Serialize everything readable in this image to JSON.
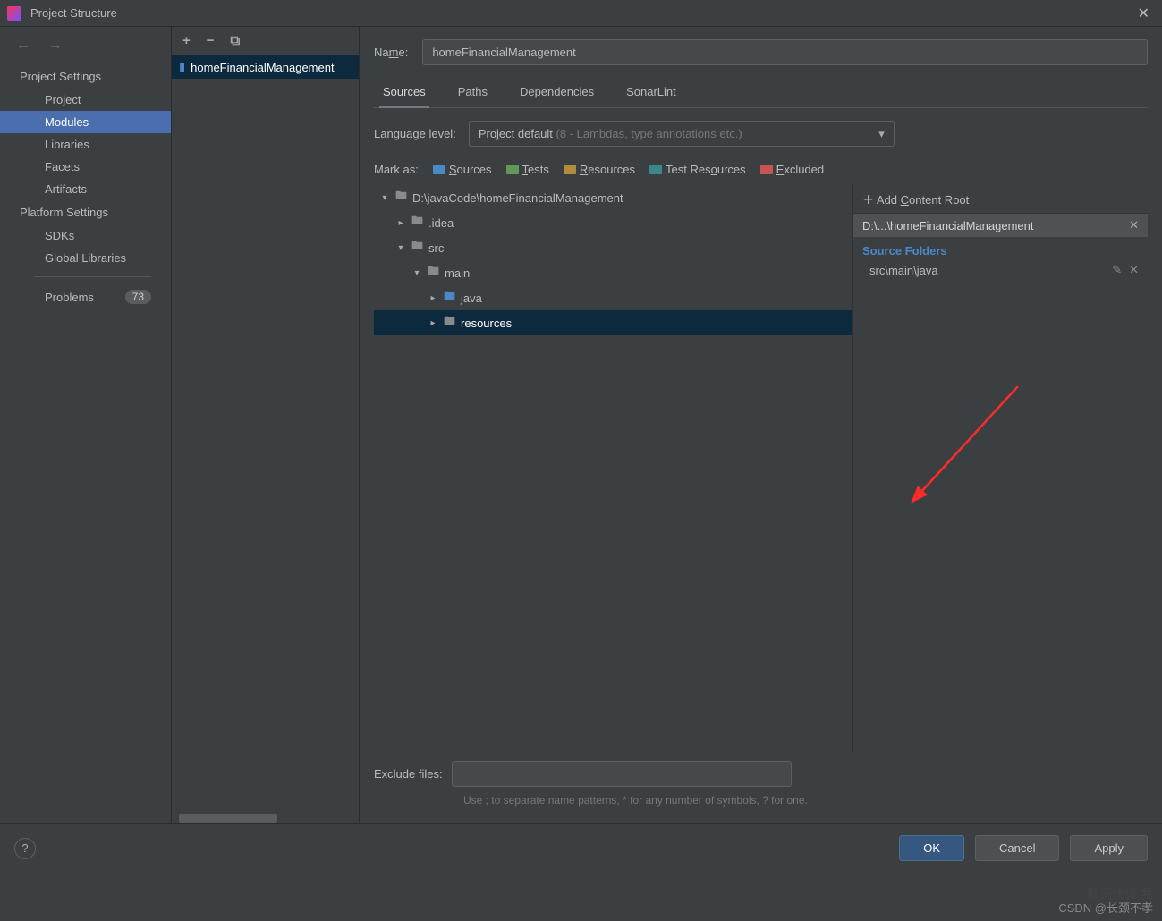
{
  "title": "Project Structure",
  "leftNav": {
    "back_arrow": "←",
    "fwd_arrow": "→",
    "sections": [
      {
        "header": "Project Settings",
        "items": [
          "Project",
          "Modules",
          "Libraries",
          "Facets",
          "Artifacts"
        ],
        "selected": "Modules"
      },
      {
        "header": "Platform Settings",
        "items": [
          "SDKs",
          "Global Libraries"
        ]
      }
    ],
    "problems": {
      "label": "Problems",
      "count": "73"
    }
  },
  "modulesList": {
    "toolbar": {
      "add": "+",
      "remove": "−",
      "copy": "⧉"
    },
    "selected": "homeFinancialManagement"
  },
  "form": {
    "name_label": "Name:",
    "name_value": "homeFinancialManagement",
    "tabs": [
      "Sources",
      "Paths",
      "Dependencies",
      "SonarLint"
    ],
    "active_tab": "Sources",
    "lang_label": "Language level:",
    "lang_value": "Project default",
    "lang_hint": " (8 - Lambdas, type annotations etc.)",
    "mark_label": "Mark as:",
    "marks": {
      "sources": "Sources",
      "tests": "Tests",
      "resources": "Resources",
      "test_resources": "Test Resources",
      "excluded": "Excluded"
    },
    "tree": {
      "root": "D:\\javaCode\\homeFinancialManagement",
      "idea": ".idea",
      "src": "src",
      "main": "main",
      "java": "java",
      "resources": "resources"
    },
    "contentRoot": {
      "add_label": "Add Content Root",
      "path": "D:\\...\\homeFinancialManagement",
      "source_folders_header": "Source Folders",
      "source_folder_1": "src\\main\\java"
    },
    "exclude_label": "Exclude files:",
    "exclude_hint": "Use ; to separate name patterns, * for any number of symbols, ? for one."
  },
  "buttons": {
    "ok": "OK",
    "cancel": "Cancel",
    "apply": "Apply"
  },
  "watermark": "CSDN @长颈不孝",
  "watermark_zh": "取词快译 我"
}
